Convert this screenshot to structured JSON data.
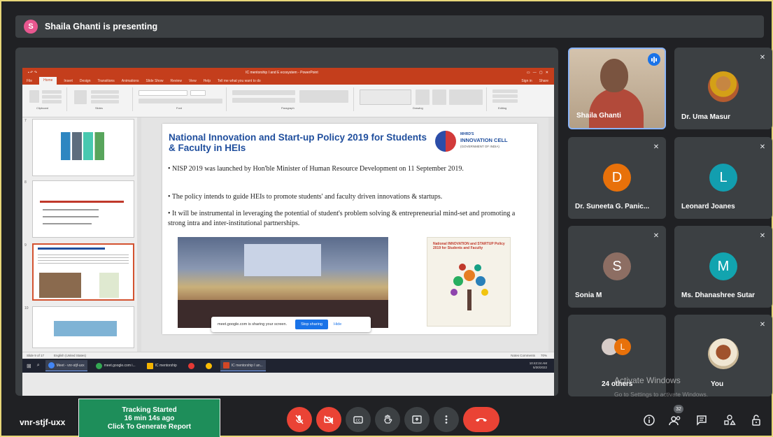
{
  "banner": {
    "avatar_letter": "S",
    "text": "Shaila Ghanti is presenting"
  },
  "ppt": {
    "window_title": "IC mentorship I and E ecosystem - PowerPoint",
    "tabs": [
      "File",
      "Home",
      "Insert",
      "Design",
      "Transitions",
      "Animations",
      "Slide Show",
      "Review",
      "View",
      "Help",
      "Tell me what you want to do"
    ],
    "active_tab": "Home",
    "signin": "Sign in",
    "share": "Share",
    "ribbon_groups": [
      "Clipboard",
      "Slides",
      "Font",
      "Paragraph",
      "Drawing",
      "Editing"
    ],
    "thumb_numbers": [
      "7",
      "8",
      "9",
      "10"
    ],
    "status_left": "Slide 9 of 17",
    "status_lang": "English (United States)",
    "status_right": "Notes   Comments",
    "zoom": "70%"
  },
  "slide": {
    "title": "National Innovation and Start-up Policy 2019 for Students & Faculty in HEIs",
    "logo_line1": "MHRD'S",
    "logo_line2": "INNOVATION CELL",
    "logo_line3": "(GOVERNMENT OF INDIA)",
    "bullets": [
      "• NISP 2019 was launched by Hon'ble Minister of Human Resource Development on 11 September 2019.",
      "• The policy intends to guide HEIs to promote students' and faculty driven innovations & startups.",
      "• It will be instrumental in leveraging the potential of student's problem solving & entrepreneurial mind-set and promoting a strong intra and inter-institutional partnerships."
    ],
    "poster_text": "National INNOVATION and STARTUP Policy 2019 for Students and Faculty"
  },
  "share_toast": {
    "text": "meet.google.com is sharing your screen.",
    "stop": "Stop sharing",
    "hide": "Hide"
  },
  "taskbar": {
    "items": [
      "Meet - vnr-stjf-uxx",
      "meet.google.com i...",
      "IC mentorship",
      "",
      "",
      "IC mentorship I an..."
    ],
    "time": "10:42:24 AM",
    "date": "5/30/2022"
  },
  "participants": [
    {
      "name": "Shaila Ghanti",
      "type": "video"
    },
    {
      "name": "Dr. Uma Masur",
      "type": "photo"
    },
    {
      "name": "Dr. Suneeta G. Panic...",
      "type": "letter",
      "letter": "D",
      "color": "#e8710a"
    },
    {
      "name": "Leonard Joanes",
      "type": "letter",
      "letter": "L",
      "color": "#129eaf"
    },
    {
      "name": "Sonia M",
      "type": "letter",
      "letter": "S",
      "color": "#8d6e63"
    },
    {
      "name": "Ms. Dhanashree Sutar",
      "type": "letter",
      "letter": "M",
      "color": "#12a4af"
    },
    {
      "name": "24 others",
      "type": "group",
      "letter": "L"
    },
    {
      "name": "You",
      "type": "photo"
    }
  ],
  "watermark": {
    "line1": "Activate Windows",
    "line2": "Go to Settings to activate Windows."
  },
  "bottom": {
    "meeting_code": "vnr-stjf-uxx",
    "tracker_line1": "Tracking Started",
    "tracker_line2": "16 min 14s ago",
    "tracker_line3": "Click To Generate Report",
    "people_count": "32"
  }
}
